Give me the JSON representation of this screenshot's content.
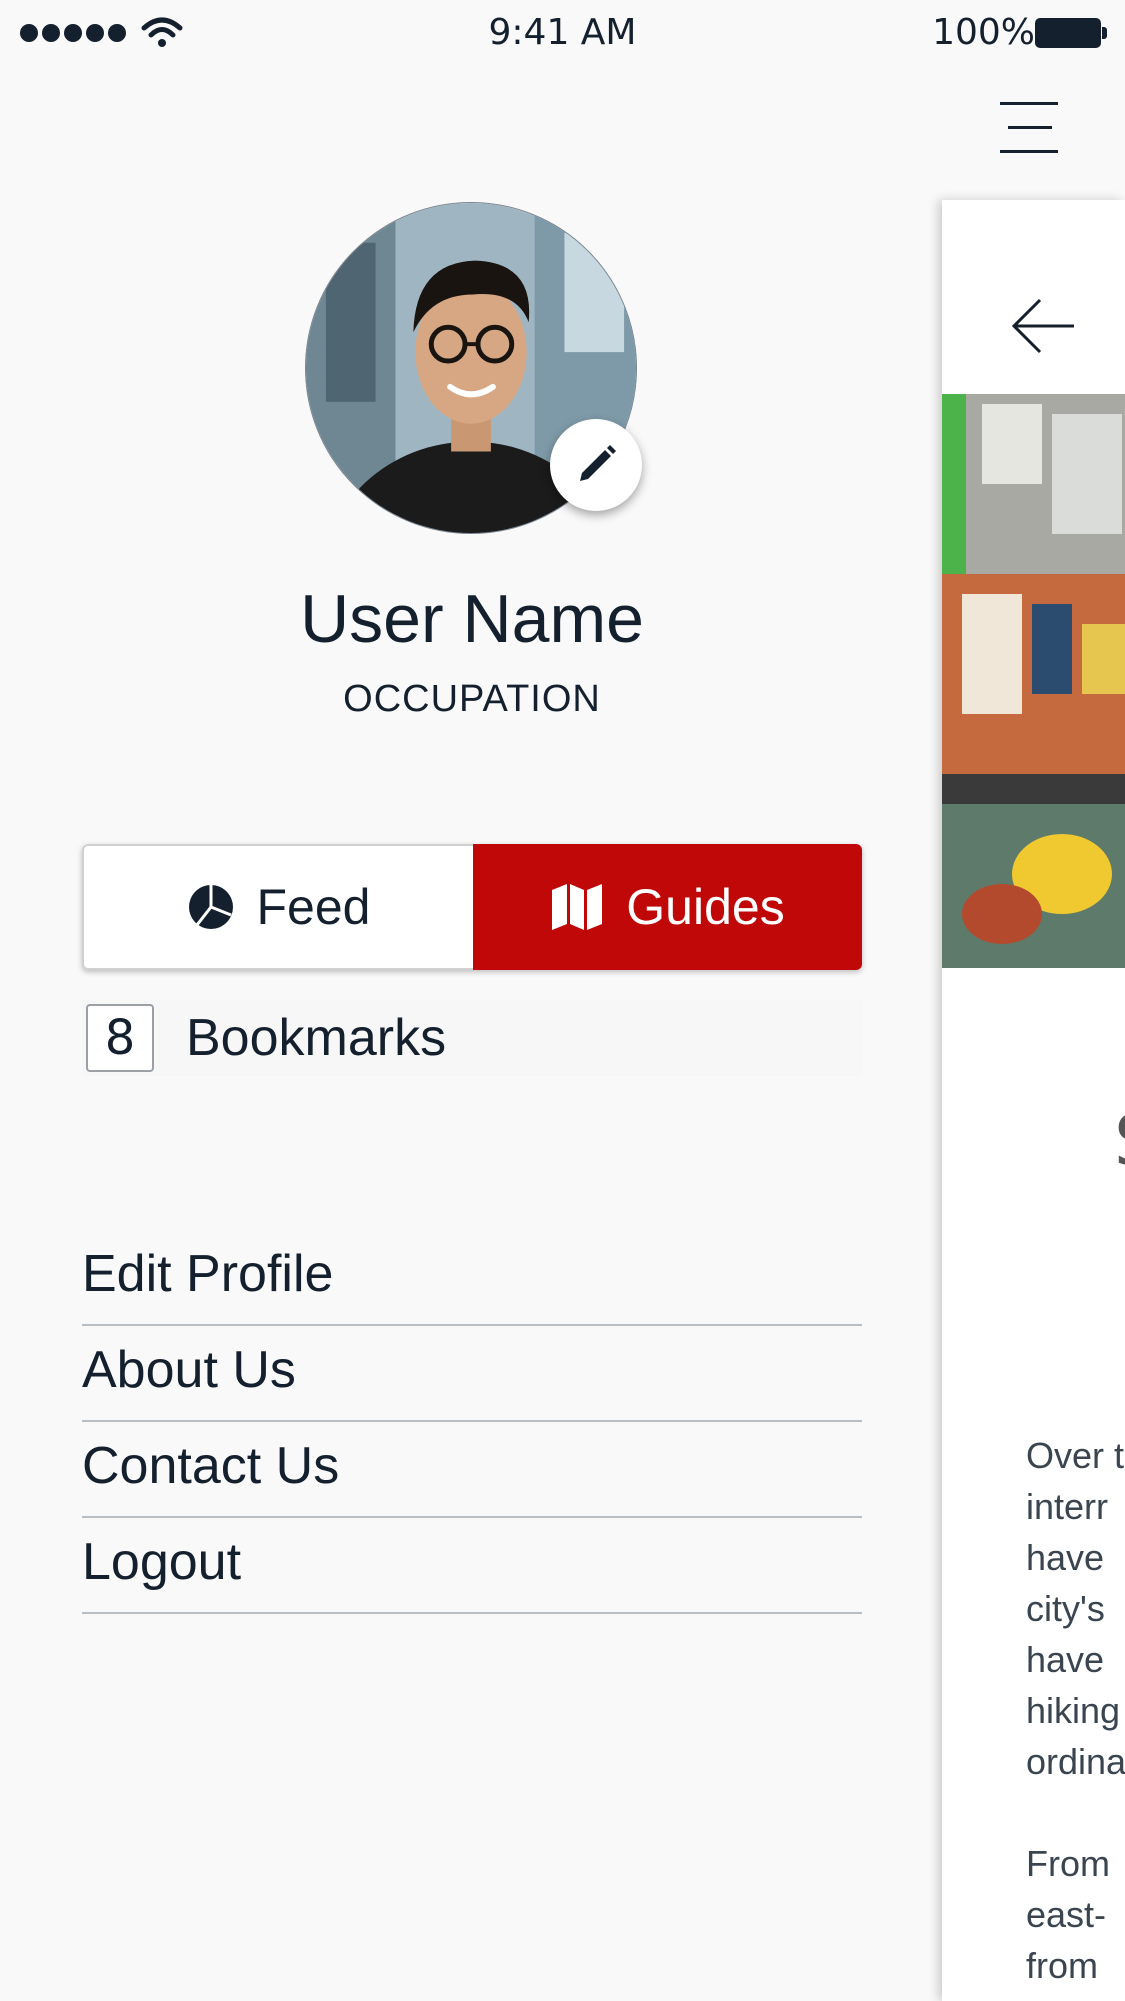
{
  "status_bar": {
    "time": "9:41 AM",
    "battery_percent": "100%",
    "signal_bars": 5
  },
  "profile": {
    "user_name": "User Name",
    "occupation": "OCCUPATION"
  },
  "segment": {
    "feed_label": "Feed",
    "guides_label": "Guides",
    "active": "Guides",
    "active_color": "#c00808"
  },
  "bookmarks": {
    "count": "8",
    "label": "Bookmarks"
  },
  "menu": {
    "items": [
      {
        "label": "Edit Profile"
      },
      {
        "label": "About Us"
      },
      {
        "label": "Contact Us"
      },
      {
        "label": "Logout"
      }
    ]
  },
  "panel": {
    "glyph": "S",
    "text_lines": [
      "Over t",
      "interr",
      "have",
      "city's",
      "have",
      "hiking",
      "ordina"
    ],
    "text_lines_2": [
      "From",
      "east-",
      "from"
    ]
  },
  "icons": {
    "menu": "hamburger-icon",
    "edit": "pencil-icon",
    "feed": "pie-chart-icon",
    "guides": "map-icon",
    "back": "arrow-left-icon"
  }
}
